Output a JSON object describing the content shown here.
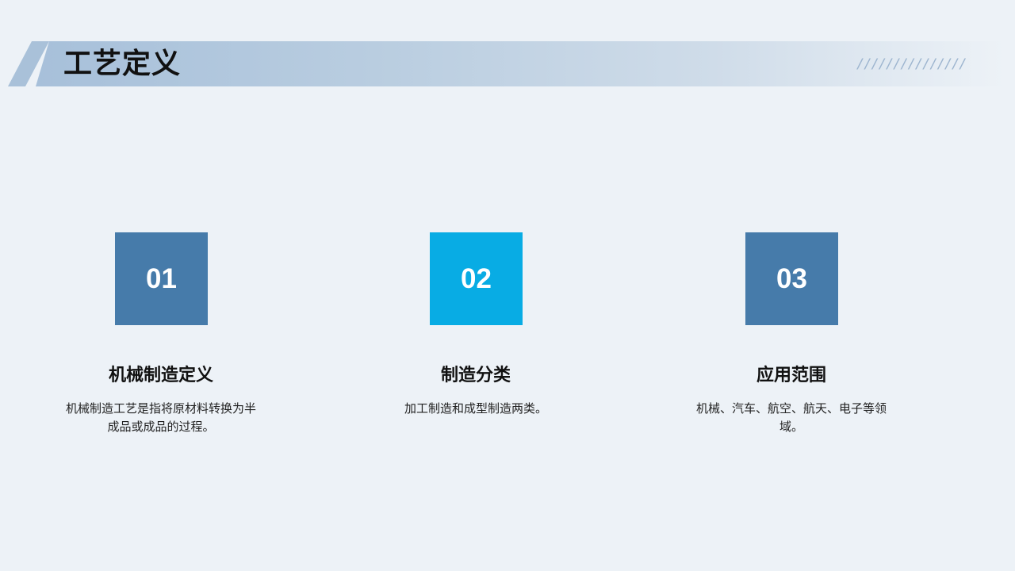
{
  "slide": {
    "title": "工艺定义",
    "decoration": "///////////////"
  },
  "colors": {
    "background": "#edf2f7",
    "banner": "#a7c0da",
    "box_steel": "#467baa",
    "box_cyan": "#08ace4"
  },
  "cards": [
    {
      "number": "01",
      "title": "机械制造定义",
      "description": "机械制造工艺是指将原材料转换为半成品或成品的过程。",
      "color": "#467baa"
    },
    {
      "number": "02",
      "title": "制造分类",
      "description": "加工制造和成型制造两类。",
      "color": "#08ace4"
    },
    {
      "number": "03",
      "title": "应用范围",
      "description": "机械、汽车、航空、航天、电子等领域。",
      "color": "#467baa"
    }
  ]
}
